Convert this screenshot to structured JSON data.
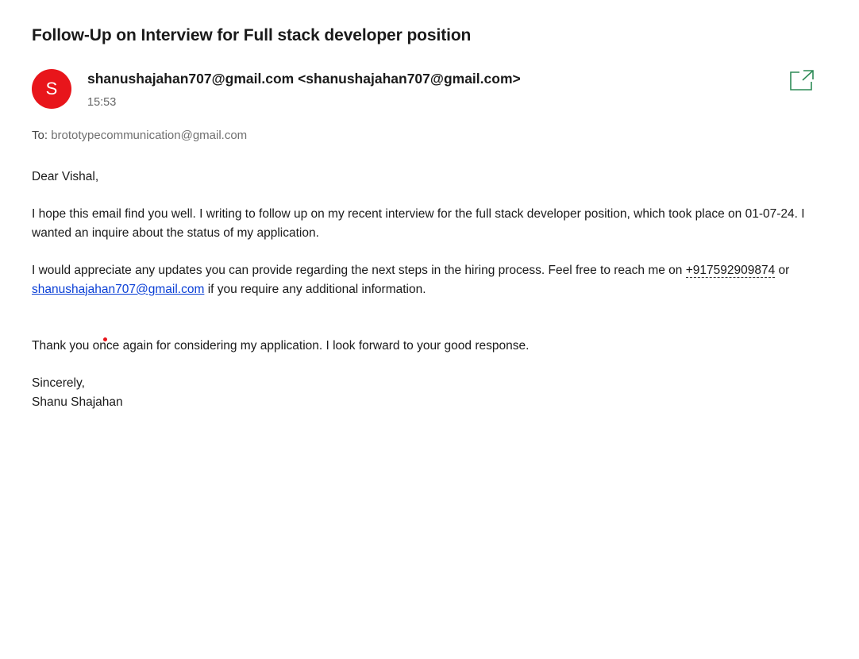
{
  "email": {
    "subject": "Follow-Up on Interview for Full stack developer position",
    "avatar_letter": "S",
    "sender": "shanushajahan707@gmail.com <shanushajahan707@gmail.com>",
    "time": "15:53",
    "to_label": "To:",
    "to_address": "brototypecommunication@gmail.com",
    "popout_icon": "popout-window-icon",
    "body": {
      "greeting": "Dear Vishal,",
      "p1": "I hope this email find you well. I writing to follow up on my recent interview for the full stack developer position, which took place on 01-07-24. I wanted an inquire about the status of my application.",
      "p2_start": "I would appreciate any updates you can provide regarding the next steps in the hiring process. Feel free to reach me on",
      "phone": "+917592909874",
      "p2_or": "or",
      "email_link": "shanushajahan707@gmail.com",
      "p2_end": "if you require any additional information.",
      "p3": "Thank you once again for considering my application. I look forward to your good response.",
      "closing": "Sincerely,",
      "signature": "Shanu Shajahan"
    }
  },
  "colors": {
    "avatar_bg": "#e8151b",
    "link": "#0a3fd6",
    "popout_icon": "#2e8b57"
  }
}
